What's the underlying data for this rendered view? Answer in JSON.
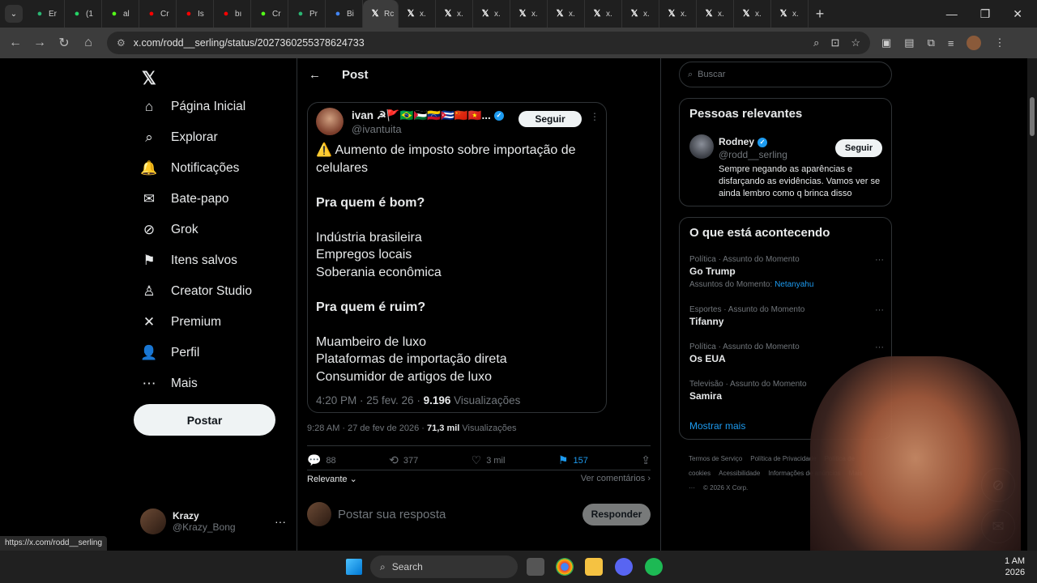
{
  "browser": {
    "tabs": [
      {
        "label": "Er",
        "icon": "letter-b-icon",
        "color": "#2bb673"
      },
      {
        "label": "(1",
        "icon": "whatsapp-icon",
        "color": "#25d366"
      },
      {
        "label": "al",
        "icon": "letter-k-icon",
        "color": "#53fc18"
      },
      {
        "label": "Cr",
        "icon": "youtube-icon",
        "color": "#ff0000"
      },
      {
        "label": "Is",
        "icon": "youtube-icon",
        "color": "#ff0000"
      },
      {
        "label": "bı",
        "icon": "youtube-icon",
        "color": "#ff0000"
      },
      {
        "label": "Cr",
        "icon": "letter-k-icon",
        "color": "#53fc18"
      },
      {
        "label": "Pr",
        "icon": "letter-b-icon",
        "color": "#2bb673"
      },
      {
        "label": "Bi",
        "icon": "chrome-icon",
        "color": "#4285f4"
      },
      {
        "label": "Rc",
        "icon": "x-icon",
        "color": "#ffffff",
        "active": true
      },
      {
        "label": "x.",
        "icon": "x-icon",
        "color": "#ffffff"
      },
      {
        "label": "x.",
        "icon": "x-icon",
        "color": "#ffffff"
      },
      {
        "label": "x.",
        "icon": "x-icon",
        "color": "#ffffff"
      },
      {
        "label": "x.",
        "icon": "x-icon",
        "color": "#ffffff"
      },
      {
        "label": "x.",
        "icon": "x-icon",
        "color": "#ffffff"
      },
      {
        "label": "x.",
        "icon": "x-icon",
        "color": "#ffffff"
      },
      {
        "label": "x.",
        "icon": "x-icon",
        "color": "#ffffff"
      },
      {
        "label": "x.",
        "icon": "x-icon",
        "color": "#ffffff"
      },
      {
        "label": "x.",
        "icon": "x-icon",
        "color": "#ffffff"
      },
      {
        "label": "x.",
        "icon": "x-icon",
        "color": "#ffffff"
      },
      {
        "label": "x.",
        "icon": "x-icon",
        "color": "#ffffff"
      }
    ],
    "url": "x.com/rodd__serling/status/2027360255378624733",
    "status_url": "https://x.com/rodd__serling"
  },
  "sidebar": {
    "logo": "𝕏",
    "items": [
      {
        "label": "Página Inicial",
        "icon": "home-icon",
        "glyph": "⌂"
      },
      {
        "label": "Explorar",
        "icon": "search-icon",
        "glyph": "⌕"
      },
      {
        "label": "Notificações",
        "icon": "bell-icon",
        "glyph": "🔔"
      },
      {
        "label": "Bate-papo",
        "icon": "mail-icon",
        "glyph": "✉"
      },
      {
        "label": "Grok",
        "icon": "grok-icon",
        "glyph": "⊘"
      },
      {
        "label": "Itens salvos",
        "icon": "bookmark-icon",
        "glyph": "⚑"
      },
      {
        "label": "Creator Studio",
        "icon": "creator-studio-icon",
        "glyph": "♙"
      },
      {
        "label": "Premium",
        "icon": "x-premium-icon",
        "glyph": "✕"
      },
      {
        "label": "Perfil",
        "icon": "user-icon",
        "glyph": "👤"
      },
      {
        "label": "Mais",
        "icon": "more-circle-icon",
        "glyph": "⋯"
      }
    ],
    "post_button": "Postar",
    "account": {
      "name": "Krazy",
      "handle": "@Krazy_Bong",
      "more": "···"
    }
  },
  "main": {
    "header_title": "Post",
    "quoted": {
      "name": "ivan ☭🚩🇧🇷🇵🇸🇻🇪🇨🇺🇨🇳🇻🇳...",
      "handle": "@ivantuita",
      "follow": "Seguir",
      "lines": [
        {
          "text": "⚠️ Aumento de imposto sobre importação de celulares",
          "bold": false
        },
        {
          "text": "",
          "bold": false
        },
        {
          "text": "Pra quem é bom?",
          "bold": true
        },
        {
          "text": "",
          "bold": false
        },
        {
          "text": "Indústria brasileira",
          "bold": false
        },
        {
          "text": "Empregos locais",
          "bold": false
        },
        {
          "text": "Soberania econômica",
          "bold": false
        },
        {
          "text": "",
          "bold": false
        },
        {
          "text": "Pra quem é ruim?",
          "bold": true
        },
        {
          "text": "",
          "bold": false
        },
        {
          "text": "Muambeiro de luxo",
          "bold": false
        },
        {
          "text": "Plataformas de importação direta",
          "bold": false
        },
        {
          "text": "Consumidor de artigos de luxo",
          "bold": false
        }
      ],
      "timestamp": "4:20 PM · 25 fev. 26 · ",
      "views_count": "9.196",
      "views_label": " Visualizações"
    },
    "post_meta": {
      "timestamp": "9:28 AM · 27 de fev de 2026 · ",
      "views_count": "71,3 mil",
      "views_label": " Visualizações"
    },
    "actions": {
      "replies": "88",
      "reposts": "377",
      "likes": "3 mil",
      "bookmarks": "157"
    },
    "sort_label": "Relevante ⌄",
    "view_quotes": "Ver comentários ›",
    "reply_placeholder": "Postar sua resposta",
    "reply_button": "Responder"
  },
  "right": {
    "search_placeholder": "Buscar",
    "relevant_title": "Pessoas relevantes",
    "relevant_person": {
      "name": "Rodney",
      "handle": "@rodd__serling",
      "follow": "Seguir",
      "bio": "Sempre negando as aparências e disfarçando as evidências. Vamos ver se ainda lembro como q brinca disso"
    },
    "trending_title": "O que está acontecendo",
    "trends": [
      {
        "category": "Política · Assunto do Momento",
        "name": "Go Trump",
        "sub_prefix": "Assuntos do Momento: ",
        "sub_link": "Netanyahu"
      },
      {
        "category": "Esportes · Assunto do Momento",
        "name": "Tifanny",
        "sub_prefix": "",
        "sub_link": ""
      },
      {
        "category": "Política · Assunto do Momento",
        "name": "Os EUA",
        "sub_prefix": "",
        "sub_link": ""
      },
      {
        "category": "Televisão · Assunto do Momento",
        "name": "Samira",
        "sub_prefix": "",
        "sub_link": ""
      }
    ],
    "show_more": "Mostrar mais",
    "footer": [
      "Termos de Serviço",
      "Política de Privacidade",
      "Política de cookies",
      "Acessibilidade",
      "Informações de anúncios",
      "Mais ···",
      "© 2026 X Corp."
    ]
  },
  "taskbar": {
    "search_label": "Search",
    "time": "1 AM",
    "date": "2026"
  }
}
